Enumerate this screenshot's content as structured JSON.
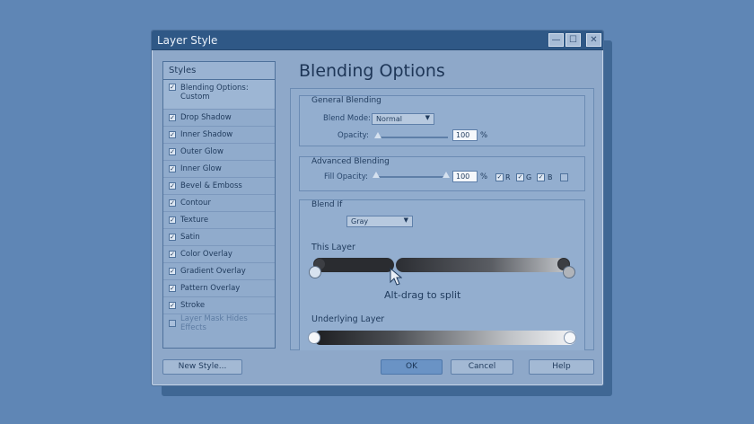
{
  "window": {
    "title": "Layer Style",
    "controls": {
      "minimize": "—",
      "maximize": "☐",
      "close": "✕"
    }
  },
  "styles_panel": {
    "title": "Styles",
    "items": [
      {
        "label_line1": "Blending Options:",
        "label_line2": "Custom",
        "checked": true
      },
      {
        "label": "Drop Shadow",
        "checked": true
      },
      {
        "label": "Inner Shadow",
        "checked": true
      },
      {
        "label": "Outer Glow",
        "checked": true
      },
      {
        "label": "Inner Glow",
        "checked": true
      },
      {
        "label": "Bevel & Emboss",
        "checked": true
      },
      {
        "label": "Contour",
        "checked": true
      },
      {
        "label": "Texture",
        "checked": true
      },
      {
        "label": "Satin",
        "checked": true
      },
      {
        "label": "Color Overlay",
        "checked": true
      },
      {
        "label": "Gradient Overlay",
        "checked": true
      },
      {
        "label": "Pattern Overlay",
        "checked": true
      },
      {
        "label": "Stroke",
        "checked": true
      },
      {
        "label": "Layer Mask Hides Effects",
        "checked": false
      }
    ]
  },
  "main": {
    "heading": "Blending Options",
    "general": {
      "title": "General Blending",
      "blend_mode_label": "Blend Mode:",
      "blend_mode_value": "Normal",
      "opacity_label": "Opacity:",
      "opacity_value": "100",
      "opacity_unit": "%",
      "opacity_level": 0.0
    },
    "advanced": {
      "title": "Advanced Blending",
      "fill_opacity_label": "Fill Opacity:",
      "fill_opacity_value": "100",
      "fill_opacity_unit": "%",
      "channels": [
        {
          "label": "R",
          "checked": true
        },
        {
          "label": "G",
          "checked": true
        },
        {
          "label": "B",
          "checked": true
        }
      ]
    },
    "blend_if": {
      "title": "Blend If",
      "channel_value": "Gray",
      "this_layer_label": "This Layer",
      "split_tip": "Alt-drag to split",
      "underlying_label": "Underlying Layer"
    }
  },
  "buttons": {
    "new_style": "New Style...",
    "ok": "OK",
    "cancel": "Cancel",
    "help": "Help"
  },
  "colors": {
    "background": "#5f86b5",
    "titlebar": "#2f5886",
    "dialog": "#8ea8c9",
    "primary_button": "#6a93c5"
  }
}
